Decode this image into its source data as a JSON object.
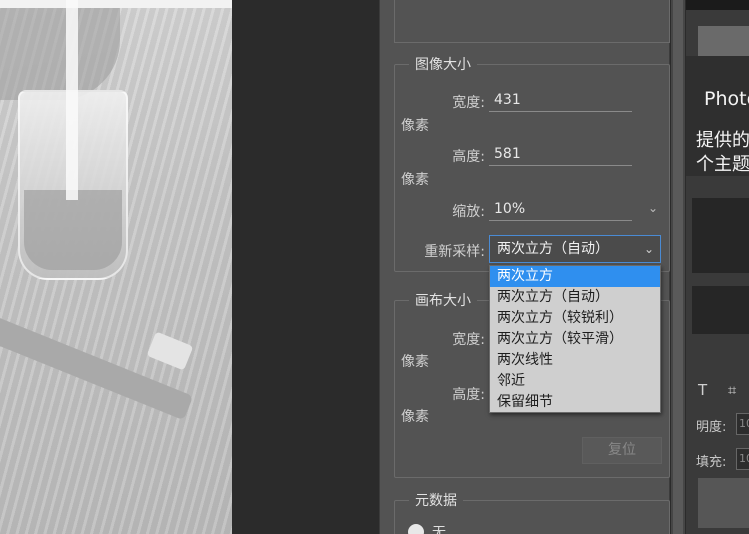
{
  "image_size": {
    "title": "图像大小",
    "width_label": "宽度:",
    "width_value": "431",
    "width_unit": "像素",
    "height_label": "高度:",
    "height_value": "581",
    "height_unit": "像素",
    "scale_label": "缩放:",
    "scale_value": "10%",
    "resample_label": "重新采样:",
    "resample_value": "两次立方（自动）"
  },
  "resample_options": [
    "两次立方",
    "两次立方（自动）",
    "两次立方（较锐利）",
    "两次立方（较平滑）",
    "两次线性",
    "邻近",
    "保留细节"
  ],
  "resample_selected_index": 0,
  "canvas_size": {
    "title": "画布大小",
    "width_label": "宽度:",
    "width_unit": "像素",
    "height_label": "高度:",
    "height_unit": "像素",
    "reset_label": "复位"
  },
  "metadata": {
    "title": "元数据",
    "first_option_partial": "无"
  },
  "right_panel": {
    "title_partial": "Photo",
    "line1_partial": "提供的",
    "line2_partial": "个主题",
    "tool_icons": "T ⌗",
    "opacity_partial": "明度:",
    "opacity_value_partial": "10",
    "fill_partial": "填充:",
    "fill_value_partial": "10"
  },
  "colors": {
    "dialog_bg": "#535353",
    "select_border": "#4a8bd4",
    "option_highlight": "#2f8fef",
    "dropdown_bg": "#cfcfcf"
  }
}
